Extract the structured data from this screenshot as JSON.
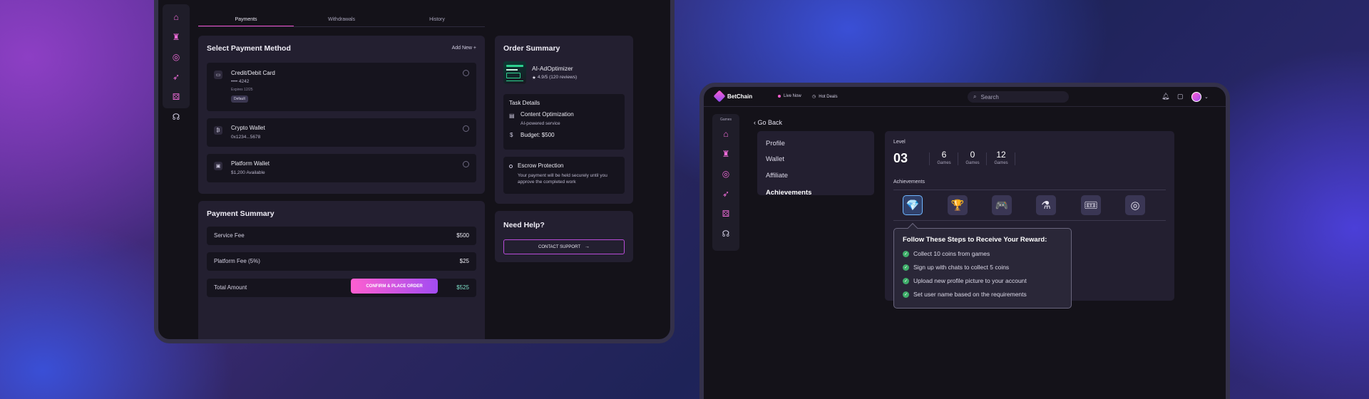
{
  "payments_screen": {
    "tabs": [
      {
        "label": "Payments"
      },
      {
        "label": "Withdrawals"
      },
      {
        "label": "History"
      }
    ],
    "select_method": {
      "title": "Select Payment Method",
      "add_new": "Add New +",
      "methods": [
        {
          "name": "Credit/Debit Card",
          "detail": "•••• 4242",
          "extra": "Expires 12/25",
          "badge": "Default",
          "icon": "credit-card-icon"
        },
        {
          "name": "Crypto Wallet",
          "detail": "0x1234...5678",
          "icon": "bitcoin-icon"
        },
        {
          "name": "Platform Wallet",
          "detail": "$1,200 Available",
          "icon": "wallet-icon"
        }
      ]
    },
    "payment_summary": {
      "title": "Payment Summary",
      "rows": [
        {
          "label": "Service Fee",
          "value": "$500"
        },
        {
          "label": "Platform Fee (5%)",
          "value": "$25"
        },
        {
          "label": "Total Amount",
          "value": "$525",
          "value_color": "#7ee0c8"
        }
      ],
      "confirm_label": "CONFIRM & PLACE ORDER"
    },
    "order_summary": {
      "title": "Order Summary",
      "product": "AI-AdOptimizer",
      "rating": "4.9/5 (120 reviews)",
      "task_details_title": "Task Details",
      "task_name": "Content Optimization",
      "task_sub": "AI-powered service",
      "budget": "Budget: $500",
      "escrow_title": "Escrow Protection",
      "escrow_text": "Your payment will be held securely until you approve the completed work"
    },
    "help": {
      "title": "Need Help?",
      "support_label": "CONTACT SUPPORT"
    },
    "sidebar_icons": [
      "home-icon",
      "castle-icon",
      "target-icon",
      "rocket-icon",
      "dice-icon",
      "headset-icon"
    ]
  },
  "profile_screen": {
    "brand": "BetChain",
    "live_now": "Live Now",
    "hot_deals": "Hot Deals",
    "search_placeholder": "Search",
    "sidebar_label": "Games",
    "go_back": "Go Back",
    "menu": [
      {
        "label": "Profile"
      },
      {
        "label": "Wallet"
      },
      {
        "label": "Affiliate"
      },
      {
        "label": "Achievements",
        "active": true
      }
    ],
    "level_label": "Level",
    "level_value": "03",
    "stats": [
      {
        "value": "6",
        "label": "Games"
      },
      {
        "value": "0",
        "label": "Games"
      },
      {
        "value": "12",
        "label": "Games"
      }
    ],
    "achievements_label": "Achievements",
    "achievement_icons": [
      "diamond-icon",
      "trophy-icon",
      "gamepad-icon",
      "potion-icon",
      "ticket-icon",
      "target-icon"
    ],
    "tooltip": {
      "title": "Follow These Steps to Receive Your Reward:",
      "steps": [
        "Collect 10 coins from games",
        "Sign up with chats to collect 5 coins",
        "Upload new profile picture to your account",
        "Set user name based on the requirements"
      ]
    }
  }
}
